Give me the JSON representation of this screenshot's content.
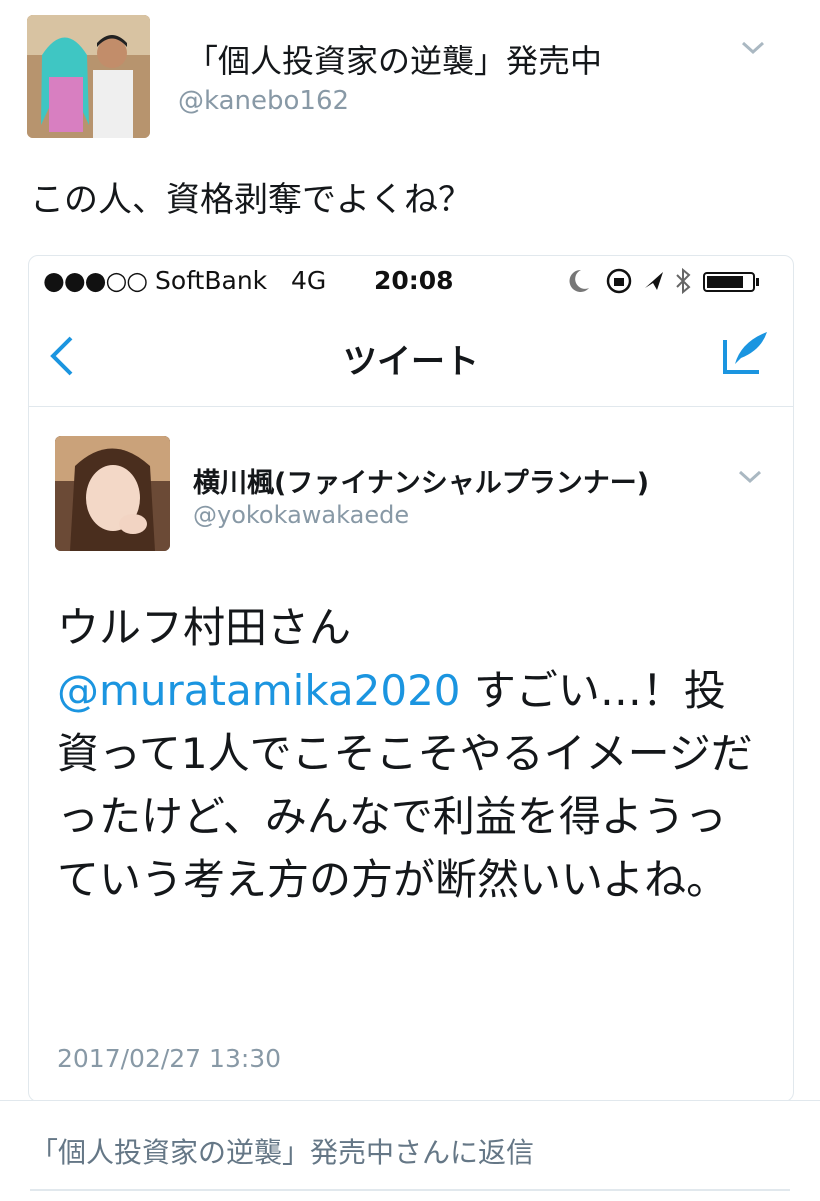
{
  "outer_tweet": {
    "display_name": "「個人投資家の逆襲」発売中",
    "handle": "@kanebo162",
    "text": "この人、資格剥奪でよくね？"
  },
  "embedded_screenshot": {
    "status_bar": {
      "signal": "●●●○○",
      "carrier": "SoftBank",
      "network": "4G",
      "time": "20:08"
    },
    "nav": {
      "title": "ツイート"
    },
    "tweet": {
      "display_name": "横川楓(ファイナンシャルプランナー)",
      "handle": "@yokokawakaede",
      "text_line1": "ウルフ村田さん",
      "mention": "@muratamika2020",
      "text_after_mention": " すごい…！投資って1人でこそこそやるイメージだったけど、みんなで利益を得ようっていう考え方の方が断然いいよね。",
      "timestamp": "2017/02/27 13:30"
    }
  },
  "reply": {
    "label": "「個人投資家の逆襲」発売中さんに返信"
  },
  "colors": {
    "link": "#1b95e0",
    "muted": "#8899a6",
    "border": "#e1e8ed"
  }
}
